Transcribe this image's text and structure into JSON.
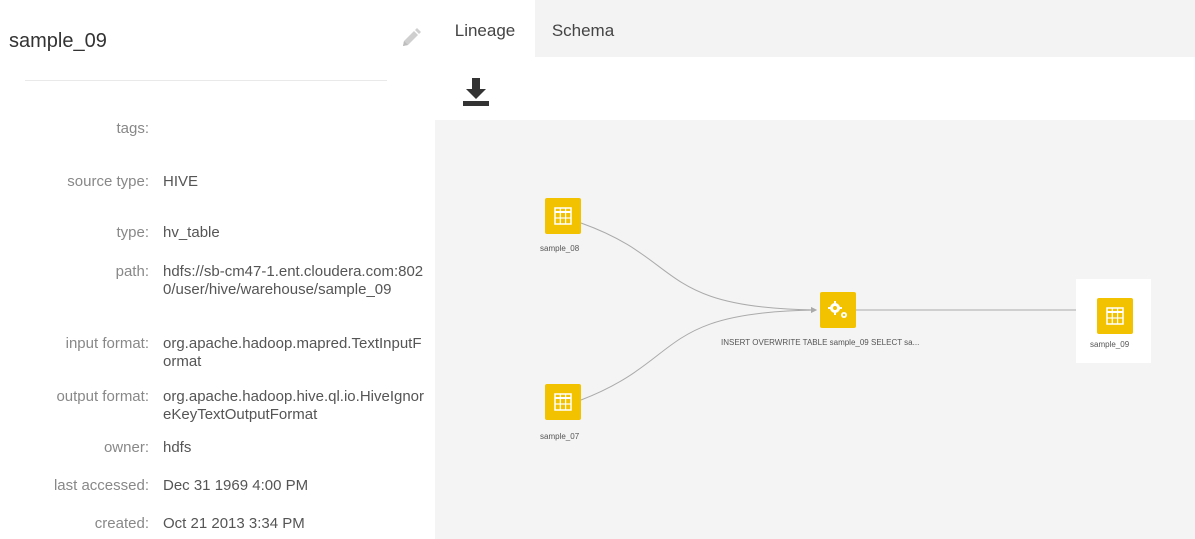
{
  "entity": {
    "title": "sample_09"
  },
  "properties": [
    {
      "label": "tags:",
      "value": ""
    },
    {
      "label": "source type:",
      "value": "HIVE"
    },
    {
      "label": "type:",
      "value": "hv_table"
    },
    {
      "label": "path:",
      "value": "hdfs://sb-cm47-1.ent.cloudera.com:8020/user/hive/warehouse/sample_09"
    },
    {
      "label": "input format:",
      "value": "org.apache.hadoop.mapred.TextInputFormat"
    },
    {
      "label": "output format:",
      "value": "org.apache.hadoop.hive.ql.io.HiveIgnoreKeyTextOutputFormat"
    },
    {
      "label": "owner:",
      "value": "hdfs"
    },
    {
      "label": "last accessed:",
      "value": "Dec 31 1969 4:00 PM"
    },
    {
      "label": "created:",
      "value": "Oct 21 2013 3:34 PM"
    }
  ],
  "tabs": {
    "lineage": "Lineage",
    "schema": "Schema",
    "active": "lineage"
  },
  "toolbar": {
    "download_icon": "download-icon"
  },
  "lineage": {
    "nodes": [
      {
        "id": "sample_08",
        "label": "sample_08",
        "icon": "table-icon"
      },
      {
        "id": "sample_07",
        "label": "sample_07",
        "icon": "table-icon"
      },
      {
        "id": "query",
        "label": "INSERT OVERWRITE TABLE sample_09 SELECT sa...",
        "icon": "gears-icon"
      },
      {
        "id": "sample_09",
        "label": "sample_09",
        "icon": "table-icon"
      }
    ],
    "edges": [
      {
        "from": "sample_08",
        "to": "query"
      },
      {
        "from": "sample_07",
        "to": "query"
      },
      {
        "from": "query",
        "to": "sample_09"
      }
    ]
  },
  "colors": {
    "node_fill": "#f2c200",
    "edge": "#aaaaaa",
    "canvas_bg": "#f4f4f4"
  }
}
